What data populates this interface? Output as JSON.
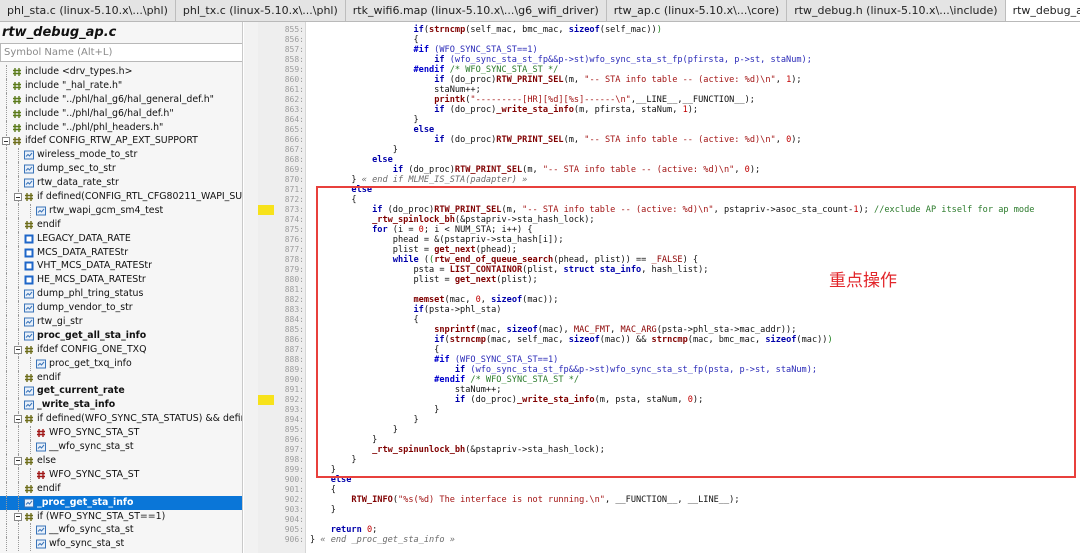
{
  "tabs": [
    {
      "label": "phl_sta.c (linux-5.10.x\\...\\phl)",
      "active": false
    },
    {
      "label": "phl_tx.c (linux-5.10.x\\...\\phl)",
      "active": false
    },
    {
      "label": "rtk_wifi6.map (linux-5.10.x\\...\\g6_wifi_driver)",
      "active": false
    },
    {
      "label": "rtw_ap.c (linux-5.10.x\\...\\core)",
      "active": false
    },
    {
      "label": "rtw_debug.h (linux-5.10.x\\...\\include)",
      "active": false
    },
    {
      "label": "rtw_debug_ap.c (linux-5.10.x\\...\\core)",
      "active": true,
      "close": "×"
    },
    {
      "label": "rtw_proc.c (linux-5.10.x\\...\\core)",
      "active": false
    }
  ],
  "panel": {
    "title": "rtw_debug_ap.c",
    "search_placeholder": "Symbol Name (Alt+L)"
  },
  "symbols": [
    {
      "label": "include <drv_types.h>",
      "icon": "include",
      "depth": 0,
      "bold": false
    },
    {
      "label": "include \"_hal_rate.h\"",
      "icon": "include",
      "depth": 0,
      "bold": false
    },
    {
      "label": "include \"../phl/hal_g6/hal_general_def.h\"",
      "icon": "include",
      "depth": 0,
      "bold": false
    },
    {
      "label": "include \"../phl/hal_g6/hal_def.h\"",
      "icon": "include",
      "depth": 0,
      "bold": false
    },
    {
      "label": "include \"../phl/phl_headers.h\"",
      "icon": "include",
      "depth": 0,
      "bold": false
    },
    {
      "label": "ifdef CONFIG_RTW_AP_EXT_SUPPORT",
      "icon": "ifdef",
      "depth": 0,
      "bold": false,
      "expander": true
    },
    {
      "label": "wireless_mode_to_str",
      "icon": "func",
      "depth": 1,
      "bold": false
    },
    {
      "label": "dump_sec_to_str",
      "icon": "func",
      "depth": 1,
      "bold": false
    },
    {
      "label": "rtw_data_rate_str",
      "icon": "func",
      "depth": 1,
      "bold": false
    },
    {
      "label": "if defined(CONFIG_RTL_CFG80211_WAPI_SUPP",
      "icon": "ifdef",
      "depth": 1,
      "bold": false,
      "expander": true
    },
    {
      "label": "rtw_wapi_gcm_sm4_test",
      "icon": "func",
      "depth": 2,
      "bold": false
    },
    {
      "label": "endif",
      "icon": "ifdef",
      "depth": 1,
      "bold": false
    },
    {
      "label": "LEGACY_DATA_RATE",
      "icon": "var",
      "depth": 1,
      "bold": false
    },
    {
      "label": "MCS_DATA_RATEStr",
      "icon": "var",
      "depth": 1,
      "bold": false
    },
    {
      "label": "VHT_MCS_DATA_RATEStr",
      "icon": "var",
      "depth": 1,
      "bold": false
    },
    {
      "label": "HE_MCS_DATA_RATEStr",
      "icon": "var",
      "depth": 1,
      "bold": false
    },
    {
      "label": "dump_phl_tring_status",
      "icon": "func",
      "depth": 1,
      "bold": false
    },
    {
      "label": "dump_vendor_to_str",
      "icon": "func",
      "depth": 1,
      "bold": false
    },
    {
      "label": "rtw_gi_str",
      "icon": "func",
      "depth": 1,
      "bold": false
    },
    {
      "label": "proc_get_all_sta_info",
      "icon": "func",
      "depth": 1,
      "bold": true
    },
    {
      "label": "ifdef CONFIG_ONE_TXQ",
      "icon": "ifdef",
      "depth": 1,
      "bold": false,
      "expander": true
    },
    {
      "label": "proc_get_txq_info",
      "icon": "func",
      "depth": 2,
      "bold": false
    },
    {
      "label": "endif",
      "icon": "ifdef",
      "depth": 1,
      "bold": false
    },
    {
      "label": "get_current_rate",
      "icon": "func",
      "depth": 1,
      "bold": true
    },
    {
      "label": "_write_sta_info",
      "icon": "func",
      "depth": 1,
      "bold": true
    },
    {
      "label": "if defined(WFO_SYNC_STA_STATUS) && define",
      "icon": "ifdef",
      "depth": 1,
      "bold": false,
      "expander": true
    },
    {
      "label": "WFO_SYNC_STA_ST",
      "icon": "hash",
      "depth": 2,
      "bold": false
    },
    {
      "label": "__wfo_sync_sta_st",
      "icon": "func",
      "depth": 2,
      "bold": false
    },
    {
      "label": "else",
      "icon": "ifdef",
      "depth": 1,
      "bold": false,
      "expander": true
    },
    {
      "label": "WFO_SYNC_STA_ST",
      "icon": "hash",
      "depth": 2,
      "bold": false
    },
    {
      "label": "endif",
      "icon": "ifdef",
      "depth": 1,
      "bold": false
    },
    {
      "label": "_proc_get_sta_info",
      "icon": "func",
      "depth": 1,
      "bold": true,
      "selected": true
    },
    {
      "label": "if (WFO_SYNC_STA_ST==1)",
      "icon": "ifdef",
      "depth": 1,
      "bold": false,
      "expander": true
    },
    {
      "label": "__wfo_sync_sta_st",
      "icon": "func",
      "depth": 2,
      "bold": false
    },
    {
      "label": "wfo_sync_sta_st",
      "icon": "func",
      "depth": 2,
      "bold": false
    }
  ],
  "editor": {
    "first_line": 855,
    "marked_lines": [
      873,
      892
    ],
    "lines": [
      [
        [
          "",
          "                    "
        ],
        [
          "kw",
          "if"
        ],
        [
          "",
          "("
        ],
        [
          "fn",
          "strncmp"
        ],
        [
          "",
          "(self_mac, bmc_mac, "
        ],
        [
          "kw",
          "sizeof"
        ],
        [
          "",
          "(self_mac))"
        ],
        [
          "br",
          ")"
        ]
      ],
      [
        [
          "",
          "                    {"
        ]
      ],
      [
        [
          "pp",
          "                    #if"
        ],
        [
          "fg",
          " (WFO_SYNC_STA_ST==1)"
        ]
      ],
      [
        [
          "",
          "                        "
        ],
        [
          "kw",
          "if"
        ],
        [
          "fg",
          " (wfo_sync_sta_st_fp&&p->st)wfo_sync_sta_st_fp(pfirsta, p->st, staNum);"
        ]
      ],
      [
        [
          "pp",
          "                    #endif"
        ],
        [
          "cm",
          " /* WFO_SYNC_STA_ST */"
        ]
      ],
      [
        [
          "",
          "                        "
        ],
        [
          "kw",
          "if"
        ],
        [
          "",
          " (do_proc)"
        ],
        [
          "fn",
          "RTW_PRINT_SEL"
        ],
        [
          "",
          "(m, "
        ],
        [
          "str",
          "\"-- STA info table -- (active: %d)\\n\""
        ],
        [
          "",
          ", "
        ],
        [
          "nu",
          "1"
        ],
        [
          "",
          ");"
        ]
      ],
      [
        [
          "",
          "                        staNum++;"
        ]
      ],
      [
        [
          "",
          "                        "
        ],
        [
          "fn",
          "printk"
        ],
        [
          "",
          "("
        ],
        [
          "str",
          "\"---------[HR][%d][%s]------\\n\""
        ],
        [
          "",
          ",__LINE__,__FUNCTION__);"
        ]
      ],
      [
        [
          "",
          "                        "
        ],
        [
          "kw",
          "if"
        ],
        [
          "",
          " (do_proc)"
        ],
        [
          "fn",
          "_write_sta_info"
        ],
        [
          "",
          "(m, pfirsta, staNum, "
        ],
        [
          "nu",
          "1"
        ],
        [
          "",
          ");"
        ]
      ],
      [
        [
          "",
          "                    }"
        ]
      ],
      [
        [
          "kw",
          "                    else"
        ]
      ],
      [
        [
          "",
          "                        "
        ],
        [
          "kw",
          "if"
        ],
        [
          "",
          " (do_proc)"
        ],
        [
          "fn",
          "RTW_PRINT_SEL"
        ],
        [
          "",
          "(m, "
        ],
        [
          "str",
          "\"-- STA info table -- (active: %d)\\n\""
        ],
        [
          "",
          ", "
        ],
        [
          "nu",
          "0"
        ],
        [
          "",
          ");"
        ]
      ],
      [
        [
          "",
          "                }"
        ]
      ],
      [
        [
          "kw",
          "            else"
        ]
      ],
      [
        [
          "",
          "                "
        ],
        [
          "kw",
          "if"
        ],
        [
          "",
          " (do_proc)"
        ],
        [
          "fn",
          "RTW_PRINT_SEL"
        ],
        [
          "",
          "(m, "
        ],
        [
          "str",
          "\"-- STA info table -- (active: %d)\\n\""
        ],
        [
          "",
          ", "
        ],
        [
          "nu",
          "0"
        ],
        [
          "",
          ");"
        ]
      ],
      [
        [
          "",
          "        } "
        ],
        [
          "tg",
          "« end if MLME_IS_STA(padapter) »"
        ]
      ],
      [
        [
          "kw",
          "        else"
        ]
      ],
      [
        [
          "",
          "        {"
        ]
      ],
      [
        [
          "",
          "            "
        ],
        [
          "kw",
          "if"
        ],
        [
          "",
          " (do_proc)"
        ],
        [
          "fn",
          "RTW_PRINT_SEL"
        ],
        [
          "",
          "(m, "
        ],
        [
          "str",
          "\"-- STA info table -- (active: %d)\\n\""
        ],
        [
          "",
          ", pstapriv->asoc_sta_count-"
        ],
        [
          "nu",
          "1"
        ],
        [
          "",
          "); "
        ],
        [
          "cm",
          "//exclude AP itself for ap mode"
        ]
      ],
      [
        [
          "",
          "            "
        ],
        [
          "fn",
          "_rtw_spinlock_bh"
        ],
        [
          "",
          "(&pstapriv->sta_hash_lock);"
        ]
      ],
      [
        [
          "",
          "            "
        ],
        [
          "kw",
          "for"
        ],
        [
          "",
          " (i = "
        ],
        [
          "nu",
          "0"
        ],
        [
          "",
          "; i < NUM_STA; i++) {"
        ]
      ],
      [
        [
          "",
          "                phead = &(pstapriv->sta_hash[i]);"
        ]
      ],
      [
        [
          "",
          "                plist = "
        ],
        [
          "fn",
          "get_next"
        ],
        [
          "",
          "(phead);"
        ]
      ],
      [
        [
          "",
          "                "
        ],
        [
          "kw",
          "while"
        ],
        [
          "",
          " ("
        ],
        [
          "br",
          "("
        ],
        [
          "fn",
          "rtw_end_of_queue_search"
        ],
        [
          "",
          "(phead, plist)) == "
        ],
        [
          "mac",
          "_FALSE"
        ],
        [
          "",
          ") {"
        ]
      ],
      [
        [
          "",
          "                    psta = "
        ],
        [
          "fn",
          "LIST_CONTAINOR"
        ],
        [
          "",
          "(plist, "
        ],
        [
          "kw",
          "struct"
        ],
        [
          "",
          " "
        ],
        [
          "kw",
          "sta_info"
        ],
        [
          "",
          ", hash_list);"
        ]
      ],
      [
        [
          "",
          "                    plist = "
        ],
        [
          "fn",
          "get_next"
        ],
        [
          "",
          "(plist);"
        ]
      ],
      [
        [
          "",
          ""
        ]
      ],
      [
        [
          "",
          "                    "
        ],
        [
          "fn",
          "memset"
        ],
        [
          "",
          "(mac, "
        ],
        [
          "nu",
          "0"
        ],
        [
          "",
          ", "
        ],
        [
          "kw",
          "sizeof"
        ],
        [
          "",
          "(mac));"
        ]
      ],
      [
        [
          "",
          "                    "
        ],
        [
          "kw",
          "if"
        ],
        [
          "",
          "(psta->phl_sta)"
        ]
      ],
      [
        [
          "",
          "                    {"
        ]
      ],
      [
        [
          "",
          "                        "
        ],
        [
          "fn",
          "snprintf"
        ],
        [
          "",
          "(mac, "
        ],
        [
          "kw",
          "sizeof"
        ],
        [
          "",
          "(mac), "
        ],
        [
          "mac",
          "MAC_FMT"
        ],
        [
          "",
          ", "
        ],
        [
          "mac",
          "MAC_ARG"
        ],
        [
          "",
          "(psta->phl_sta->mac_addr));"
        ]
      ],
      [
        [
          "",
          "                        "
        ],
        [
          "kw",
          "if"
        ],
        [
          "",
          "("
        ],
        [
          "fn",
          "strncmp"
        ],
        [
          "",
          "(mac, self_mac, "
        ],
        [
          "kw",
          "sizeof"
        ],
        [
          "",
          "(mac)) && "
        ],
        [
          "fn",
          "strncmp"
        ],
        [
          "",
          "(mac, bmc_mac, "
        ],
        [
          "kw",
          "sizeof"
        ],
        [
          "",
          "(mac))"
        ],
        [
          "br",
          ")"
        ]
      ],
      [
        [
          "",
          "                        {"
        ]
      ],
      [
        [
          "pp",
          "                        #if"
        ],
        [
          "fg",
          " (WFO_SYNC_STA_ST==1)"
        ]
      ],
      [
        [
          "",
          "                            "
        ],
        [
          "kw",
          "if"
        ],
        [
          "fg",
          " (wfo_sync_sta_st_fp&&p->st)wfo_sync_sta_st_fp(psta, p->st, staNum);"
        ]
      ],
      [
        [
          "pp",
          "                        #endif"
        ],
        [
          "cm",
          " /* WFO_SYNC_STA_ST */"
        ]
      ],
      [
        [
          "",
          "                            staNum++;"
        ]
      ],
      [
        [
          "",
          "                            "
        ],
        [
          "kw",
          "if"
        ],
        [
          "",
          " (do_proc)"
        ],
        [
          "fn",
          "_write_sta_info"
        ],
        [
          "",
          "(m, psta, staNum, "
        ],
        [
          "nu",
          "0"
        ],
        [
          "",
          ");"
        ]
      ],
      [
        [
          "",
          "                        }"
        ]
      ],
      [
        [
          "",
          "                    }"
        ]
      ],
      [
        [
          "",
          "                }"
        ]
      ],
      [
        [
          "",
          "            }"
        ]
      ],
      [
        [
          "",
          "            "
        ],
        [
          "fn",
          "_rtw_spinunlock_bh"
        ],
        [
          "",
          "(&pstapriv->sta_hash_lock);"
        ]
      ],
      [
        [
          "",
          "        }"
        ]
      ],
      [
        [
          "",
          "    }"
        ]
      ],
      [
        [
          "kw",
          "    else"
        ]
      ],
      [
        [
          "",
          "    {"
        ]
      ],
      [
        [
          "",
          "        "
        ],
        [
          "fn",
          "RTW_INFO"
        ],
        [
          "",
          "("
        ],
        [
          "str",
          "\"%s(%d) The interface is not running.\\n\""
        ],
        [
          "",
          ", __FUNCTION__, __LINE__);"
        ]
      ],
      [
        [
          "",
          "    }"
        ]
      ],
      [
        [
          "",
          ""
        ]
      ],
      [
        [
          "",
          "    "
        ],
        [
          "kw",
          "return"
        ],
        [
          "",
          " "
        ],
        [
          "nu",
          "0"
        ],
        [
          "",
          ";"
        ]
      ],
      [
        [
          "",
          "} "
        ],
        [
          "tg",
          "« end _proc_get_sta_info »"
        ]
      ]
    ]
  },
  "annotation": "重点操作",
  "colors": {
    "selection": "#0a76d8",
    "highlight_box": "#e8403c",
    "annotation": "#e2262b",
    "line_marker": "#f7e21a"
  }
}
